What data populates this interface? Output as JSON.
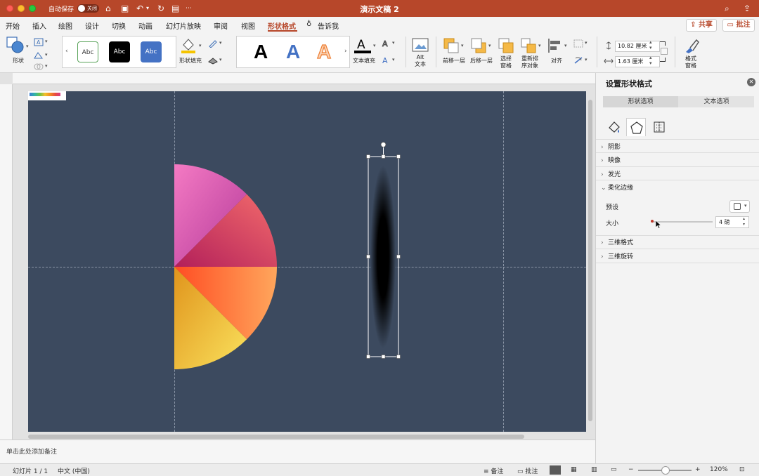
{
  "titlebar": {
    "autosave_label": "自动保存",
    "toggle_label": "关闭",
    "doc_title": "演示文稿 2"
  },
  "menu": {
    "tabs": [
      "开始",
      "插入",
      "绘图",
      "设计",
      "切换",
      "动画",
      "幻灯片放映",
      "审阅",
      "视图",
      "形状格式",
      "告诉我"
    ],
    "active_tab": "形状格式",
    "share_label": "共享",
    "comment_label": "批注"
  },
  "ribbon": {
    "shape_label": "形状",
    "style_samples": [
      "Abc",
      "Abc",
      "Abc"
    ],
    "shape_fill_label": "形状填充",
    "wordart_letters": [
      "A",
      "A",
      "A"
    ],
    "text_fill_label": "文本填充",
    "alt_text_label": "Alt\n文本",
    "bring_forward_label": "前移一层",
    "send_backward_label": "后移一层",
    "selection_pane_label": "选择\n窗格",
    "reorder_label": "重新排\n序对象",
    "align_label": "对齐",
    "height_value": "10.82 厘米",
    "width_value": "1.63 厘米",
    "format_pane_label": "格式\n窗格"
  },
  "notes_placeholder": "单击此处添加备注",
  "pane": {
    "title": "设置形状格式",
    "tabs": [
      "形状选项",
      "文本选项"
    ],
    "active_tab": "形状选项",
    "sections": {
      "shadow": "阴影",
      "reflection": "映像",
      "glow": "发光",
      "soft_edges": "柔化边缘",
      "format_3d": "三维格式",
      "rotation_3d": "三维旋转"
    },
    "soft_edges": {
      "preset_label": "预设",
      "size_label": "大小",
      "size_value": "4 磅",
      "slider_level": 0.02
    }
  },
  "status": {
    "slide_counter": "幻灯片 1 / 1",
    "language": "中文 (中国)",
    "notes_label": "备注",
    "comments_label": "批注",
    "zoom": "120%"
  },
  "colors": {
    "brand": "#b7472a",
    "slide_bg": "#3c4a5f",
    "pie_colors": [
      "#f06fb8",
      "#d9416f",
      "#ff6a3d",
      "#f5d34a"
    ]
  }
}
